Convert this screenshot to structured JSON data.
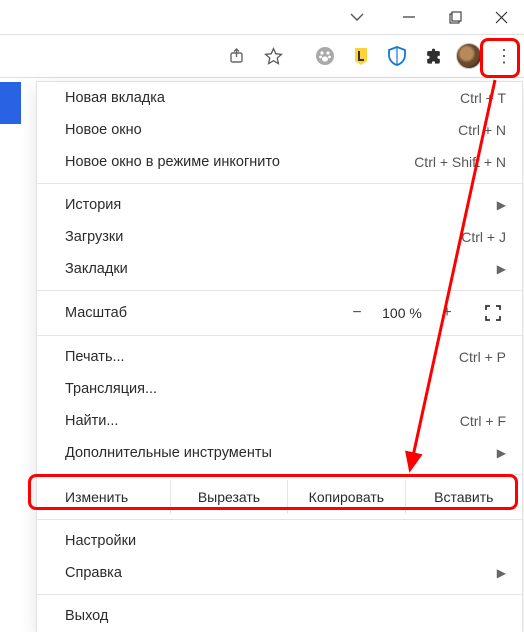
{
  "menu": {
    "new_tab": {
      "label": "Новая вкладка",
      "shortcut": "Ctrl + T"
    },
    "new_window": {
      "label": "Новое окно",
      "shortcut": "Ctrl + N"
    },
    "incognito": {
      "label": "Новое окно в режиме инкогнито",
      "shortcut": "Ctrl + Shift + N"
    },
    "history": {
      "label": "История"
    },
    "downloads": {
      "label": "Загрузки",
      "shortcut": "Ctrl + J"
    },
    "bookmarks": {
      "label": "Закладки"
    },
    "zoom": {
      "label": "Масштаб",
      "minus": "−",
      "value": "100 %",
      "plus": "+"
    },
    "print": {
      "label": "Печать...",
      "shortcut": "Ctrl + P"
    },
    "cast": {
      "label": "Трансляция..."
    },
    "find": {
      "label": "Найти...",
      "shortcut": "Ctrl + F"
    },
    "moretools": {
      "label": "Дополнительные инструменты"
    },
    "edit": {
      "label": "Изменить",
      "cut": "Вырезать",
      "copy": "Копировать",
      "paste": "Вставить"
    },
    "settings": {
      "label": "Настройки"
    },
    "help": {
      "label": "Справка"
    },
    "exit": {
      "label": "Выход"
    }
  },
  "submenu_arrow": "▶"
}
